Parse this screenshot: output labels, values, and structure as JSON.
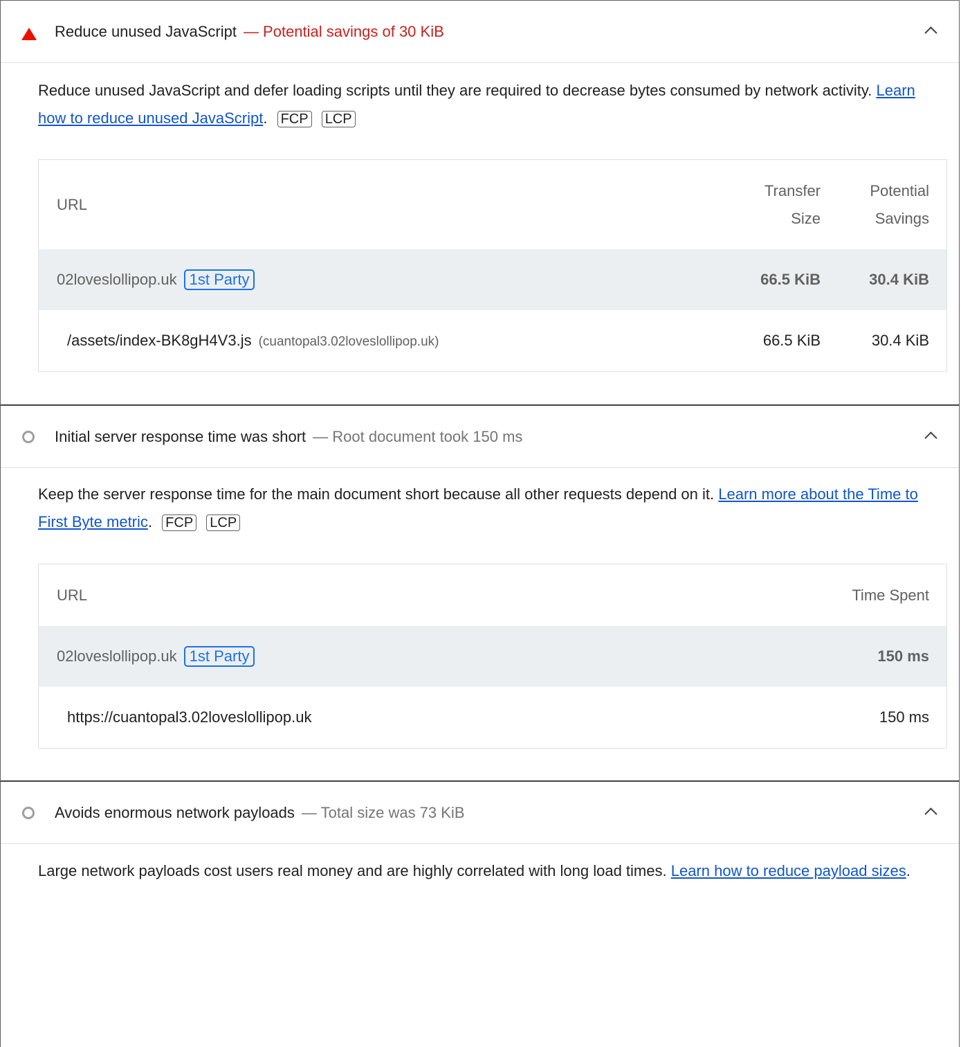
{
  "audits": [
    {
      "title": "Reduce unused JavaScript",
      "display": "— Potential savings of 30 KiB",
      "description": "Reduce unused JavaScript and defer loading scripts until they are required to decrease bytes consumed by network activity. ",
      "link": "Learn how to reduce unused JavaScript",
      "after_link": ".",
      "metrics": [
        "FCP",
        "LCP"
      ],
      "table": {
        "headers": {
          "url": "URL",
          "transfer_line1": "Transfer",
          "transfer_line2": "Size",
          "savings_line1": "Potential",
          "savings_line2": "Savings"
        },
        "group": {
          "entity": "02loveslollipop.uk",
          "badge": "1st Party",
          "transfer": "66.5 KiB",
          "savings": "30.4 KiB"
        },
        "rows": [
          {
            "url": "/assets/index-BK8gH4V3.js",
            "host": "(cuantopal3.02loveslollipop.uk)",
            "transfer": "66.5 KiB",
            "savings": "30.4 KiB"
          }
        ]
      }
    },
    {
      "title": "Initial server response time was short",
      "display": "— Root document took 150 ms",
      "description": "Keep the server response time for the main document short because all other requests depend on it. ",
      "link": "Learn more about the Time to First Byte metric",
      "after_link": ".",
      "metrics": [
        "FCP",
        "LCP"
      ],
      "table": {
        "headers": {
          "url": "URL",
          "time": "Time Spent"
        },
        "group": {
          "entity": "02loveslollipop.uk",
          "badge": "1st Party",
          "time": "150 ms"
        },
        "rows": [
          {
            "url": "https://cuantopal3.02loveslollipop.uk",
            "time": "150 ms"
          }
        ]
      }
    },
    {
      "title": "Avoids enormous network payloads",
      "display": "— Total size was 73 KiB",
      "description": "Large network payloads cost users real money and are highly correlated with long load times. ",
      "link": "Learn how to reduce payload sizes",
      "after_link": "."
    }
  ]
}
